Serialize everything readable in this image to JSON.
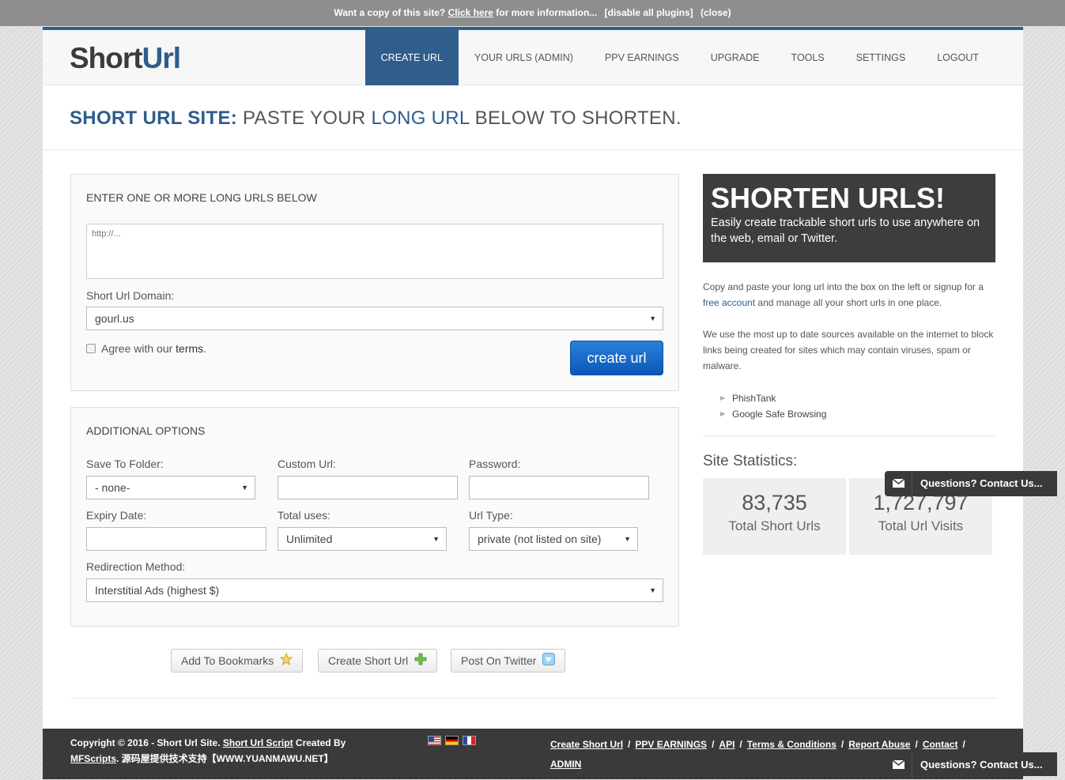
{
  "topbar": {
    "pre": "Want a copy of this site?",
    "link": "Click here",
    "post": "for more information...",
    "disable": "[disable all plugins]",
    "close": "(close)"
  },
  "logo": {
    "part1": "Short",
    "part2": "Url"
  },
  "nav": [
    {
      "label": "CREATE URL",
      "active": true
    },
    {
      "label": "YOUR URLS (ADMIN)",
      "active": false
    },
    {
      "label": "PPV EARNINGS",
      "active": false
    },
    {
      "label": "UPGRADE",
      "active": false
    },
    {
      "label": "TOOLS",
      "active": false
    },
    {
      "label": "SETTINGS",
      "active": false
    },
    {
      "label": "LOGOUT",
      "active": false
    }
  ],
  "hero": {
    "strong": "SHORT URL SITE:",
    "a": "PASTE YOUR",
    "hl": "LONG URL",
    "b": "BELOW TO SHORTEN."
  },
  "main_form": {
    "title": "ENTER ONE OR MORE LONG URLS BELOW",
    "url_placeholder": "http://...",
    "domain_label": "Short Url Domain:",
    "domain_value": "gourl.us",
    "agree_prefix": "Agree with our",
    "agree_link": "terms",
    "agree_suffix": ".",
    "create_button": "create url"
  },
  "options": {
    "title": "ADDITIONAL OPTIONS",
    "folder_label": "Save To Folder:",
    "folder_value": "- none-",
    "custom_label": "Custom Url:",
    "custom_value": "",
    "password_label": "Password:",
    "password_value": "",
    "expiry_label": "Expiry Date:",
    "expiry_value": "",
    "uses_label": "Total uses:",
    "uses_value": "Unlimited",
    "type_label": "Url Type:",
    "type_value": "private (not listed on site)",
    "redirect_label": "Redirection Method:",
    "redirect_value": "Interstitial Ads (highest $)"
  },
  "actions": {
    "bookmarks": "Add To Bookmarks",
    "create_short": "Create Short Url",
    "twitter": "Post On Twitter"
  },
  "sidebar": {
    "promo_title": "SHORTEN URLS!",
    "promo_text": "Easily create trackable short urls to use anywhere on the web, email or Twitter.",
    "p1_a": "Copy and paste your long url into the box on the left or signup for a",
    "p1_link": "free account",
    "p1_b": "and manage all your short urls in one place.",
    "p2": "We use the most up to date sources available on the internet to block links being created for sites which may contain viruses, spam or malware.",
    "sources": [
      "PhishTank",
      "Google Safe Browsing"
    ],
    "stats_title": "Site Statistics:",
    "total_urls": "83,735",
    "total_urls_label": "Total Short Urls",
    "total_visits": "1,727,797",
    "total_visits_label": "Total Url Visits"
  },
  "footer": {
    "copy_a": "Copyright © 2016 - Short Url Site.",
    "copy_link": "Short Url Script",
    "copy_b": "Created By",
    "copy_link2": "MFScripts",
    "copy_c": ". 源码屋提供技术支持【WWW.YUANMAWU.NET】",
    "links": [
      "Create Short Url",
      "PPV EARNINGS",
      "API",
      "Terms & Conditions",
      "Report Abuse",
      "Contact",
      "ADMIN"
    ]
  },
  "contact_tab": "Questions? Contact Us...",
  "colors": {
    "brand": "#2f5d8c",
    "button": "#0b57b8",
    "dark": "#3a3a3a"
  }
}
